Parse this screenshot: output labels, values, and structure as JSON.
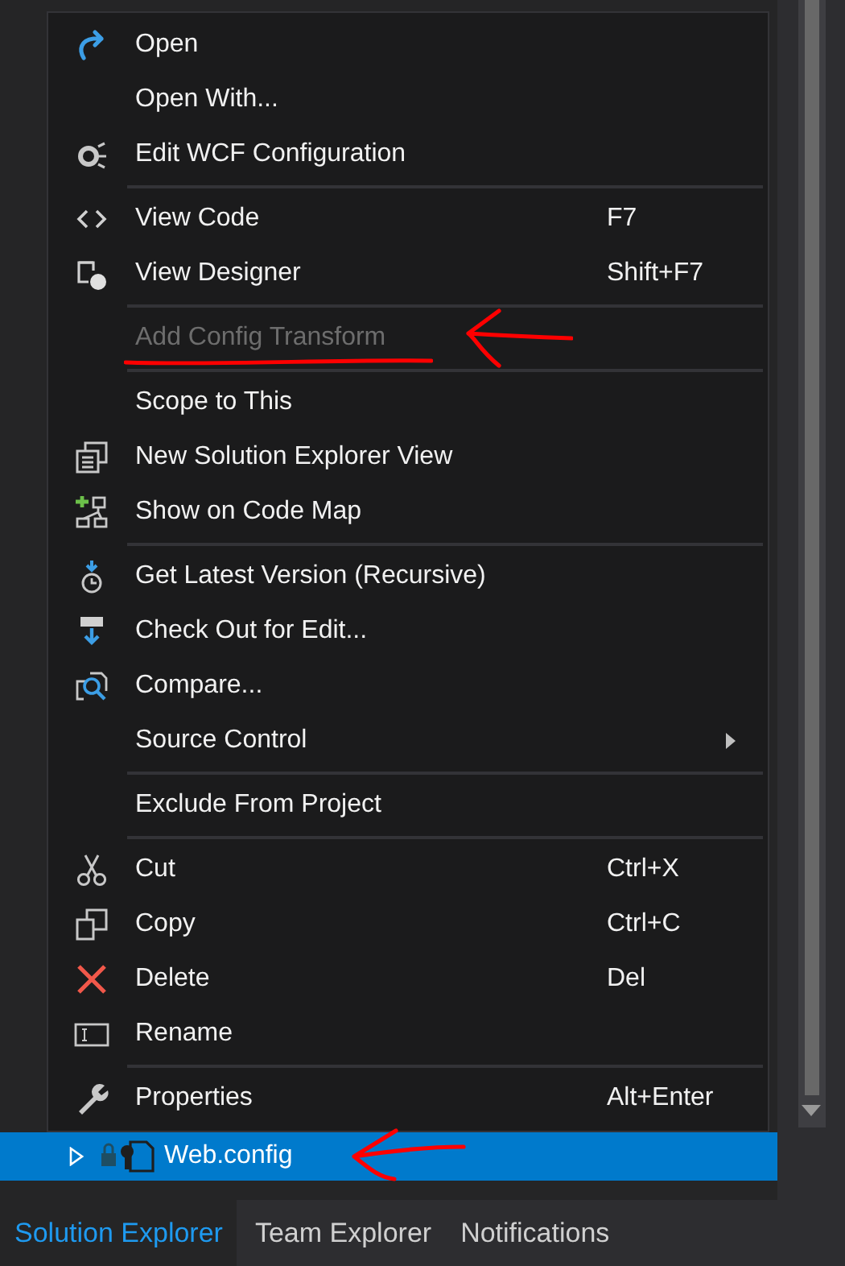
{
  "context_menu": {
    "groups": [
      [
        {
          "label": "Open",
          "disabled": false,
          "submenu": false
        },
        {
          "label": "Open With...",
          "disabled": false,
          "submenu": false
        },
        {
          "label": "Edit WCF Configuration",
          "disabled": false,
          "submenu": false
        }
      ],
      [
        {
          "label": "View Code",
          "shortcut": "F7",
          "disabled": false,
          "submenu": false
        },
        {
          "label": "View Designer",
          "shortcut": "Shift+F7",
          "disabled": false,
          "submenu": false
        }
      ],
      [
        {
          "label": "Add Config Transform",
          "disabled": true,
          "submenu": false
        }
      ],
      [
        {
          "label": "Scope to This",
          "disabled": false,
          "submenu": false
        },
        {
          "label": "New Solution Explorer View",
          "disabled": false,
          "submenu": false
        },
        {
          "label": "Show on Code Map",
          "disabled": false,
          "submenu": false
        }
      ],
      [
        {
          "label": "Get Latest Version (Recursive)",
          "disabled": false,
          "submenu": false
        },
        {
          "label": "Check Out for Edit...",
          "disabled": false,
          "submenu": false
        },
        {
          "label": "Compare...",
          "disabled": false,
          "submenu": false
        },
        {
          "label": "Source Control",
          "disabled": false,
          "submenu": true
        }
      ],
      [
        {
          "label": "Exclude From Project",
          "disabled": false,
          "submenu": false
        }
      ],
      [
        {
          "label": "Cut",
          "shortcut": "Ctrl+X",
          "disabled": false,
          "submenu": false
        },
        {
          "label": "Copy",
          "shortcut": "Ctrl+C",
          "disabled": false,
          "submenu": false
        },
        {
          "label": "Delete",
          "shortcut": "Del",
          "disabled": false,
          "submenu": false
        },
        {
          "label": "Rename",
          "disabled": false,
          "submenu": false
        }
      ],
      [
        {
          "label": "Properties",
          "shortcut": "Alt+Enter",
          "disabled": false,
          "submenu": false
        }
      ]
    ]
  },
  "tree": {
    "items": [
      {
        "label": "Web.config",
        "selected": true,
        "expanded": false
      }
    ]
  },
  "tabs": [
    {
      "label": "Solution Explorer",
      "selected": true
    },
    {
      "label": "Team Explorer",
      "selected": false
    },
    {
      "label": "Notifications",
      "selected": false
    }
  ]
}
